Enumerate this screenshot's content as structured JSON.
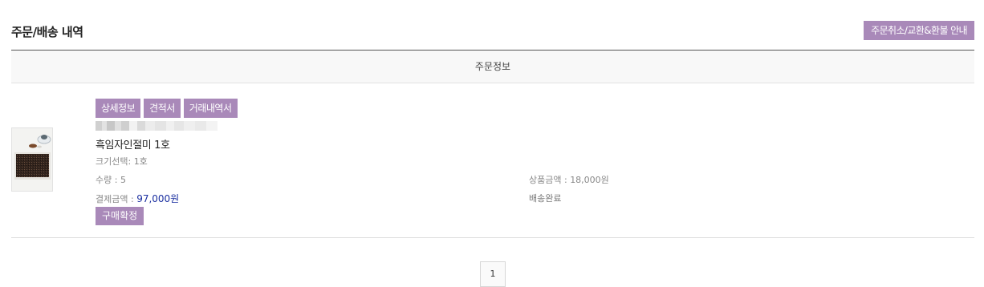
{
  "page": {
    "title": "주문/배송 내역",
    "guide_button": "주문취소/교환&환불 안내",
    "table_header": "주문정보"
  },
  "order": {
    "buttons": [
      "상세정보",
      "견적서",
      "거래내역서"
    ],
    "product_name": "흑임자인절미 1호",
    "option": {
      "label": "크기선택",
      "value": "1호"
    },
    "quantity": {
      "label": "수량",
      "value": "5"
    },
    "price": {
      "label": "상품금액",
      "value": "18,000원"
    },
    "payment": {
      "label": "결제금액",
      "value": "97,000원"
    },
    "status": "배송완료",
    "confirm_button": "구매확정"
  },
  "pagination": {
    "current": "1"
  },
  "colors": {
    "accent": "#a989b9",
    "payment_amount": "#1a2fa0"
  }
}
